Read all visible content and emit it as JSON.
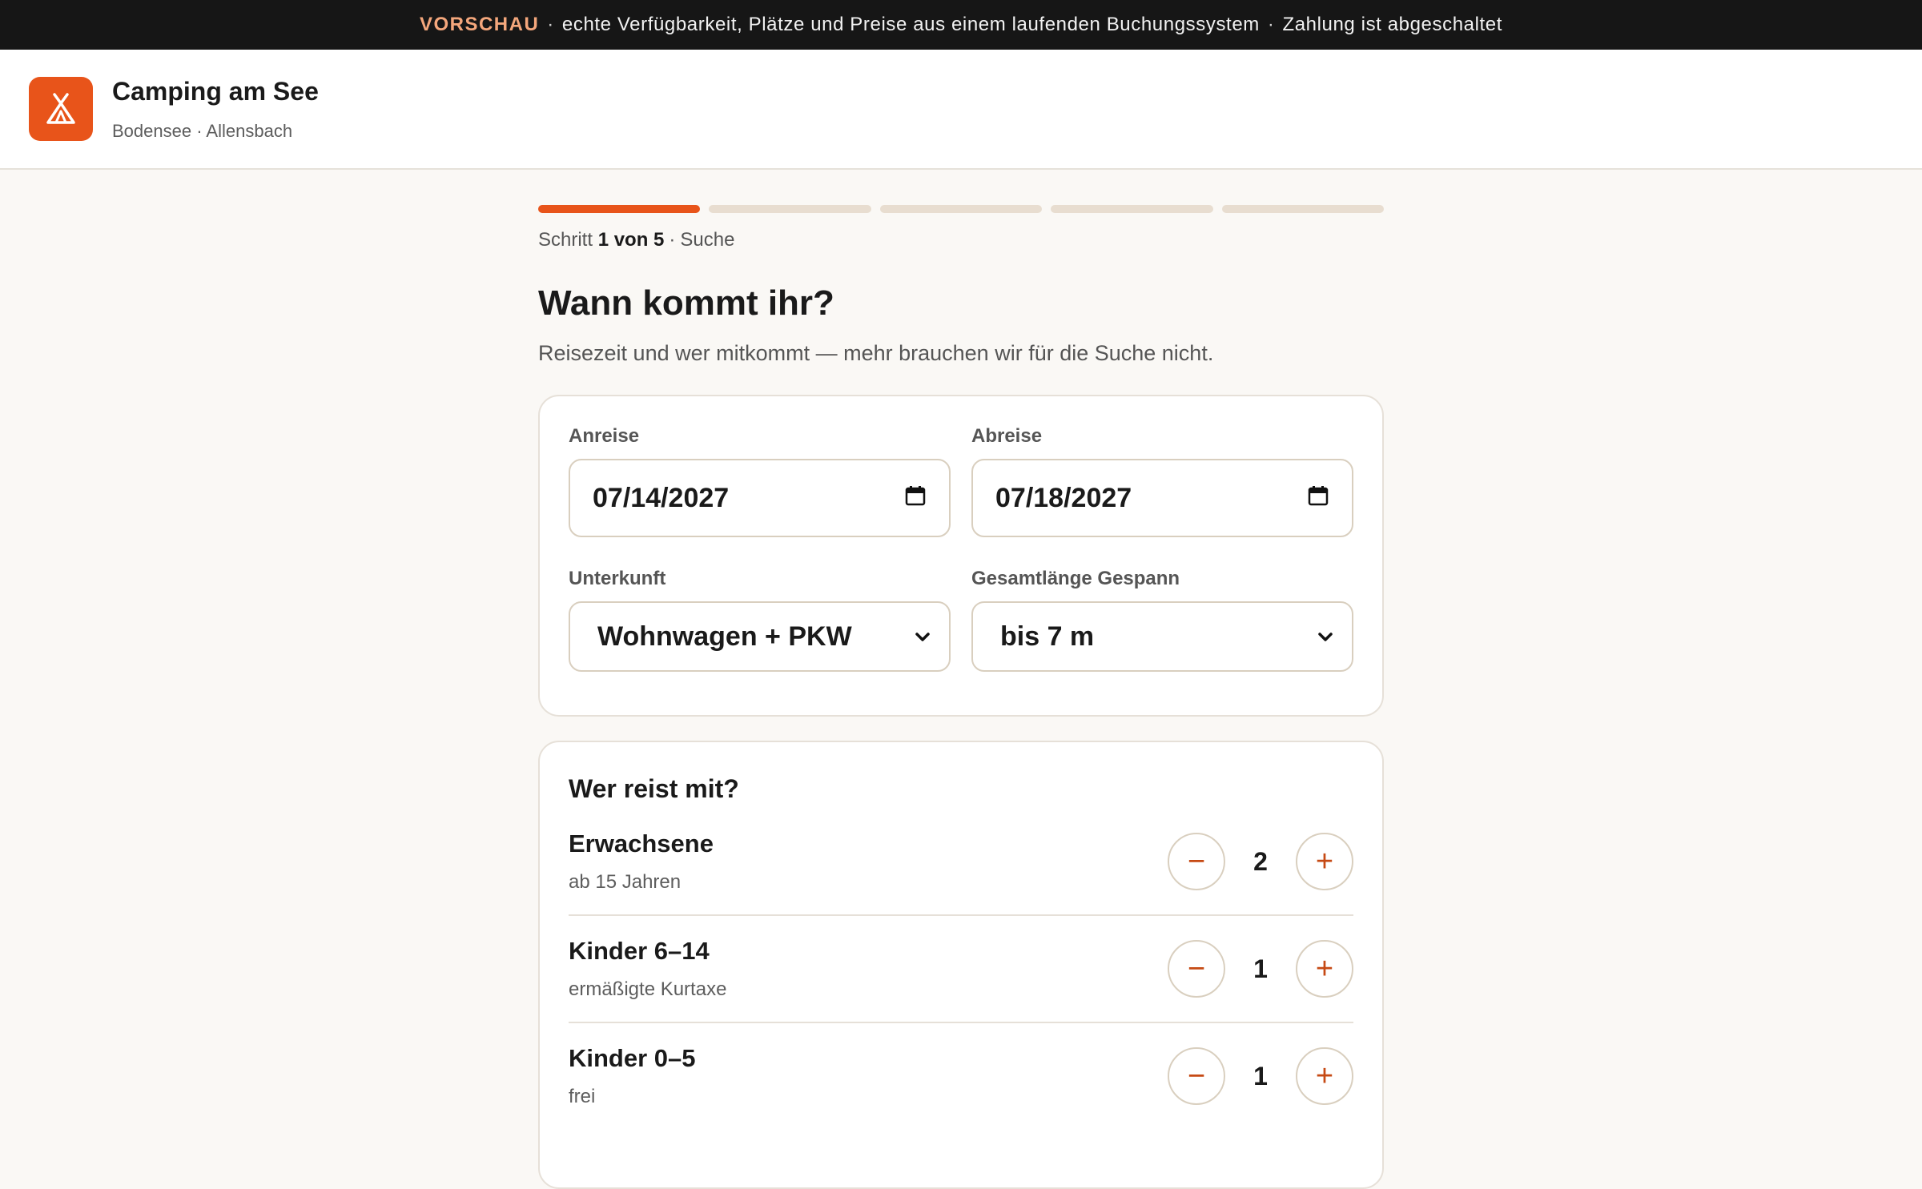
{
  "banner": {
    "tag": "VORSCHAU",
    "text1": "echte Verfügbarkeit, Plätze und Preise aus einem laufenden Buchungssystem",
    "text2": "Zahlung ist abgeschaltet"
  },
  "brand": {
    "title": "Camping am See",
    "subtitle": "Bodensee · Allensbach",
    "icon": "tent-icon",
    "color": "#e8541a"
  },
  "progress": {
    "steps_total": 5,
    "current_step": 1,
    "prefix": "Schritt",
    "position": "1 von 5",
    "name": "Suche"
  },
  "page": {
    "title": "Wann kommt ihr?",
    "subtitle": "Reisezeit und wer mitkommt — mehr brauchen wir für die Suche nicht."
  },
  "form": {
    "arrival_label": "Anreise",
    "arrival_value": "07/14/2027",
    "departure_label": "Abreise",
    "departure_value": "07/18/2027",
    "accommodation_label": "Unterkunft",
    "accommodation_value": "Wohnwagen + PKW",
    "length_label": "Gesamtlänge Gespann",
    "length_value": "bis 7 m"
  },
  "guests": {
    "title": "Wer reist mit?",
    "rows": [
      {
        "name": "Erwachsene",
        "sub": "ab 15 Jahren",
        "count": "2"
      },
      {
        "name": "Kinder 6–14",
        "sub": "ermäßigte Kurtaxe",
        "count": "1"
      },
      {
        "name": "Kinder 0–5",
        "sub": "frei",
        "count": "1"
      }
    ],
    "minus": "−",
    "plus": "+"
  },
  "colors": {
    "accent": "#e8541a",
    "banner_bg": "#161616",
    "banner_tag": "#f4a77c"
  }
}
